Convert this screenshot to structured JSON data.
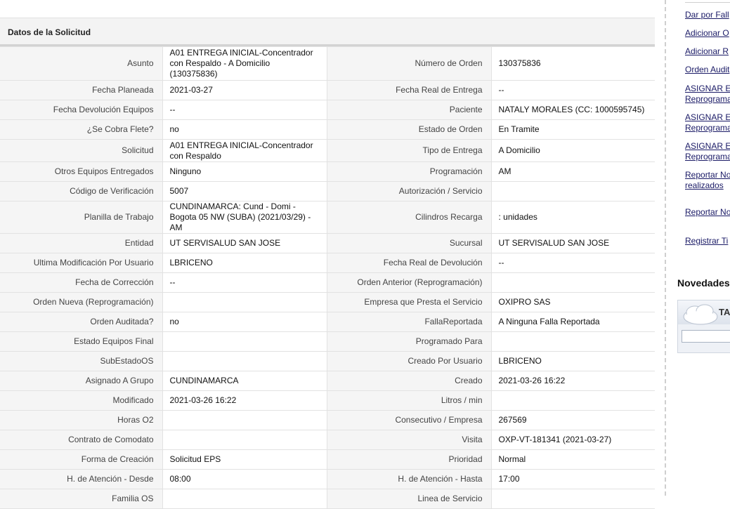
{
  "panel": {
    "title": "Datos de la Solicitud"
  },
  "rows": [
    {
      "l1": "Asunto",
      "v1": "A01 ENTREGA INICIAL-Concentrador con Respaldo - A Domicilio (130375836)",
      "l2": "Número de Orden",
      "v2": "130375836"
    },
    {
      "l1": "Fecha Planeada",
      "v1": "2021-03-27",
      "l2": "Fecha Real de Entrega",
      "v2": "--"
    },
    {
      "l1": "Fecha Devolución Equipos",
      "v1": "--",
      "l2": "Paciente",
      "v2": "NATALY MORALES (CC: 1000595745)"
    },
    {
      "l1": "¿Se Cobra Flete?",
      "v1": "no",
      "l2": "Estado de Orden",
      "v2": "En Tramite"
    },
    {
      "l1": "Solicitud",
      "v1": "A01 ENTREGA INICIAL-Concentrador con Respaldo",
      "l2": "Tipo de Entrega",
      "v2": "A Domicilio"
    },
    {
      "l1": "Otros Equipos Entregados",
      "v1": "Ninguno",
      "l2": "Programación",
      "v2": "AM"
    },
    {
      "l1": "Código de Verificación",
      "v1": "5007",
      "l2": "Autorización / Servicio",
      "v2": ""
    },
    {
      "l1": "Planilla de Trabajo",
      "v1": "CUNDINAMARCA: Cund - Domi - Bogota 05 NW (SUBA) (2021/03/29) - AM",
      "l2": "Cilindros Recarga",
      "v2": ": unidades"
    },
    {
      "l1": "Entidad",
      "v1": "UT SERVISALUD SAN JOSE",
      "l2": "Sucursal",
      "v2": "UT SERVISALUD SAN JOSE"
    },
    {
      "l1": "Ultima Modificación Por Usuario",
      "v1": "LBRICENO",
      "l2": "Fecha Real de Devolución",
      "v2": "--"
    },
    {
      "l1": "Fecha de Corrección",
      "v1": "--",
      "l2": "Orden Anterior (Reprogramación)",
      "v2": ""
    },
    {
      "l1": "Orden Nueva (Reprogramación)",
      "v1": "",
      "l2": "Empresa que Presta el Servicio",
      "v2": "OXIPRO SAS"
    },
    {
      "l1": "Orden Auditada?",
      "v1": "no",
      "l2": "FallaReportada",
      "v2": "A Ninguna Falla Reportada"
    },
    {
      "l1": "Estado Equipos Final",
      "v1": "",
      "l2": "Programado Para",
      "v2": ""
    },
    {
      "l1": "SubEstadoOS",
      "v1": "",
      "l2": "Creado Por Usuario",
      "v2": "LBRICENO"
    },
    {
      "l1": "Asignado A Grupo",
      "v1": "CUNDINAMARCA",
      "l2": "Creado",
      "v2": "2021-03-26 16:22"
    },
    {
      "l1": "Modificado",
      "v1": "2021-03-26 16:22",
      "l2": "Litros / min",
      "v2": ""
    },
    {
      "l1": "Horas O2",
      "v1": "",
      "l2": "Consecutivo / Empresa",
      "v2": "267569"
    },
    {
      "l1": "Contrato de Comodato",
      "v1": "",
      "l2": "Visita",
      "v2": "OXP-VT-181341 (2021-03-27)"
    },
    {
      "l1": "Forma de Creación",
      "v1": "Solicitud EPS",
      "l2": "Prioridad",
      "v2": "Normal"
    },
    {
      "l1": "H. de Atención - Desde",
      "v1": "08:00",
      "l2": "H. de Atención - Hasta",
      "v2": "17:00"
    },
    {
      "l1": "Familia OS",
      "v1": "",
      "l2": "Linea de Servicio",
      "v2": ""
    }
  ],
  "sidebar": {
    "links": [
      "Dar por Fall",
      "Adicionar O",
      "Adicionar R",
      "Orden Audit",
      "ASIGNAR E\nReprograma",
      "ASIGNAR E\nReprograma",
      "ASIGNAR E\nReprograma",
      "Reportar No\nrealizados",
      "Reportar No",
      "Registrar Ti"
    ],
    "novedades_title": "Novedades",
    "widget_text": "TA"
  }
}
